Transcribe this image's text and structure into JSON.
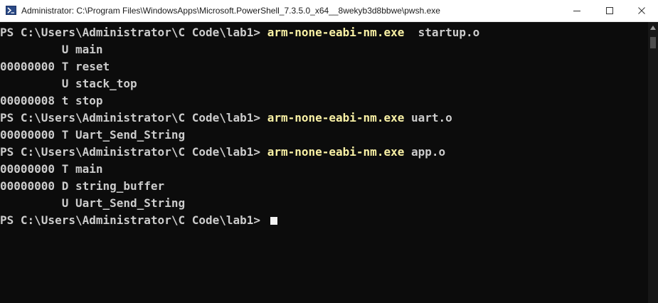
{
  "window": {
    "title": "Administrator: C:\\Program Files\\WindowsApps\\Microsoft.PowerShell_7.3.5.0_x64__8wekyb3d8bbwe\\pwsh.exe",
    "icon": "powershell-icon",
    "controls": [
      "minimize-icon",
      "maximize-icon",
      "close-icon"
    ]
  },
  "colors": {
    "background": "#0c0c0c",
    "text": "#cccccc",
    "command": "#f9f1a5",
    "cursor": "#f2f2f2"
  },
  "console": {
    "prompt": "PS C:\\Users\\Administrator\\C Code\\lab1> ",
    "lines": [
      {
        "type": "prompt",
        "cmd": "arm-none-eabi-nm.exe",
        "arg": "  startup.o"
      },
      {
        "type": "output",
        "text": "         U main"
      },
      {
        "type": "output",
        "text": "00000000 T reset"
      },
      {
        "type": "output",
        "text": "         U stack_top"
      },
      {
        "type": "output",
        "text": "00000008 t stop"
      },
      {
        "type": "prompt",
        "cmd": "arm-none-eabi-nm.exe",
        "arg": " uart.o"
      },
      {
        "type": "output",
        "text": "00000000 T Uart_Send_String"
      },
      {
        "type": "prompt",
        "cmd": "arm-none-eabi-nm.exe",
        "arg": " app.o"
      },
      {
        "type": "output",
        "text": "00000000 T main"
      },
      {
        "type": "output",
        "text": "00000000 D string_buffer"
      },
      {
        "type": "output",
        "text": "         U Uart_Send_String"
      },
      {
        "type": "prompt",
        "cmd": "",
        "arg": "",
        "cursor": true
      }
    ]
  }
}
